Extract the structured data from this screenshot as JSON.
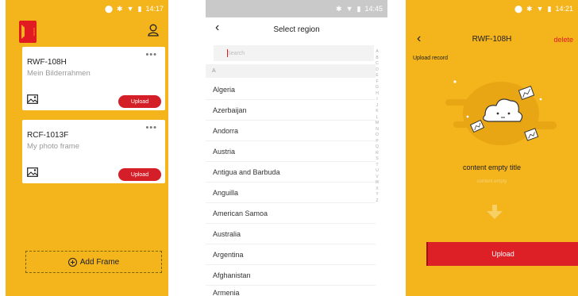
{
  "screen1": {
    "status_time": "14:17",
    "brand_label": "KODAK",
    "frames": [
      {
        "name": "RWF-108H",
        "subtitle": "Mein Bilderrahmen",
        "more": "•••",
        "upload_label": "Upload"
      },
      {
        "name": "RCF-1013F",
        "subtitle": "My photo frame",
        "more": "•••",
        "upload_label": "Upload"
      }
    ],
    "add_frame_label": "Add Frame"
  },
  "screen2": {
    "status_time": "14:45",
    "back_glyph": "‹",
    "title": "Select region",
    "search_placeholder": "Search",
    "section_letter": "A",
    "countries": [
      "Algeria",
      "Azerbaijan",
      "Andorra",
      "Austria",
      "Antigua and Barbuda",
      "Anguilla",
      "American Samoa",
      "Australia",
      "Argentina",
      "Afghanistan",
      "Armenia"
    ],
    "alphabet": [
      "A",
      "B",
      "C",
      "D",
      "E",
      "F",
      "G",
      "H",
      "I",
      "J",
      "K",
      "L",
      "M",
      "N",
      "O",
      "P",
      "Q",
      "R",
      "S",
      "T",
      "U",
      "V",
      "W",
      "X",
      "Y",
      "Z"
    ]
  },
  "screen3": {
    "status_time": "14:21",
    "back_glyph": "‹",
    "title": "RWF-108H",
    "delete_label": "delete",
    "upload_record_label": "Upload record",
    "empty_title": "content empty title",
    "empty_subtitle": "content empty",
    "upload_label": "Upload"
  },
  "colors": {
    "brand_yellow": "#f3b41c",
    "brand_red": "#e21a22",
    "upload_red": "#d41f29"
  }
}
